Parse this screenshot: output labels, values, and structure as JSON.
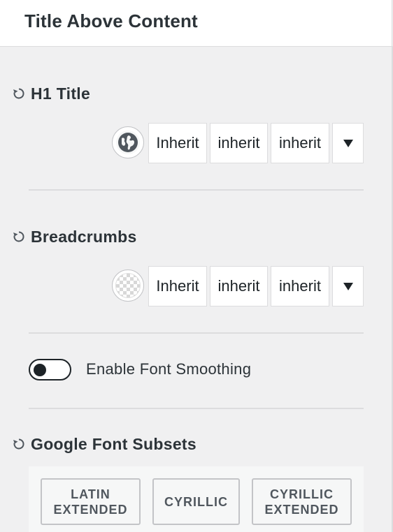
{
  "header": {
    "title": "Title Above Content"
  },
  "sections": {
    "h1": {
      "title": "H1 Title",
      "values": [
        "Inherit",
        "inherit",
        "inherit"
      ]
    },
    "breadcrumbs": {
      "title": "Breadcrumbs",
      "values": [
        "Inherit",
        "inherit",
        "inherit"
      ]
    }
  },
  "font_smoothing": {
    "label": "Enable Font Smoothing",
    "enabled": false
  },
  "subsets": {
    "title": "Google Font Subsets",
    "buttons": [
      "LATIN\nEXTENDED",
      "CYRILLIC",
      "CYRILLIC\nEXTENDED"
    ]
  },
  "icons": {
    "reset": "reset-icon",
    "color_picker": "globe-icon",
    "transparent": "checkerboard-icon",
    "dropdown": "triangle-down-icon"
  },
  "colors": {
    "background": "#f0f0f1",
    "text": "#2c3338",
    "border": "#dcdcde"
  }
}
